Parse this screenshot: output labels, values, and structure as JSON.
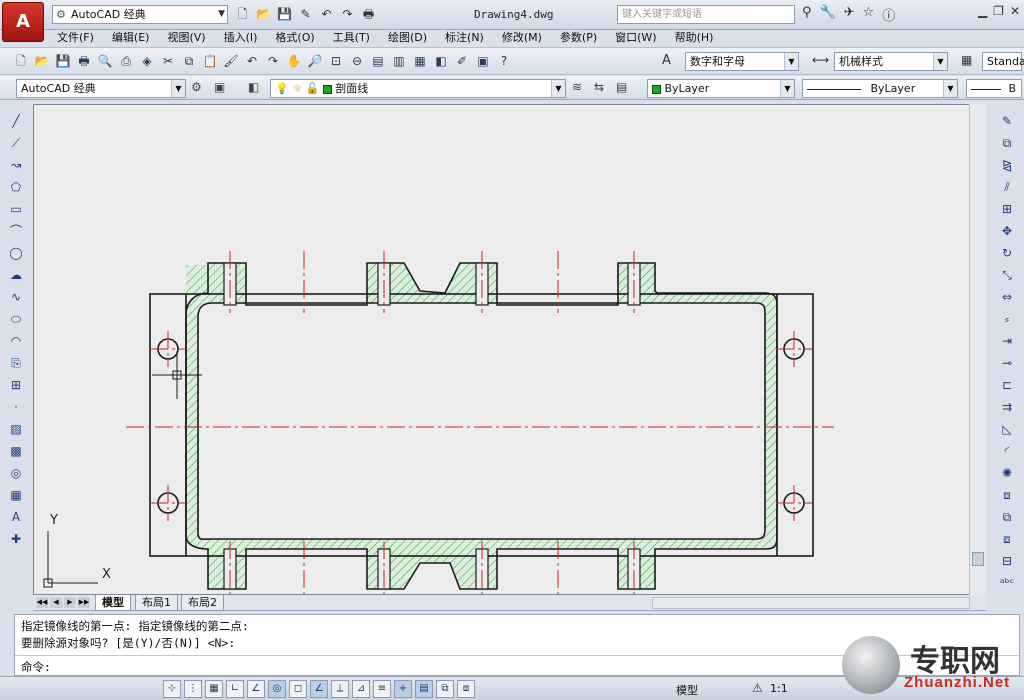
{
  "app": {
    "logo_letter": "A",
    "workspace": "AutoCAD 经典",
    "document_title": "Drawing4.dwg",
    "search_placeholder": "键入关键字或短语"
  },
  "menu": [
    "文件(F)",
    "编辑(E)",
    "视图(V)",
    "插入(I)",
    "格式(O)",
    "工具(T)",
    "绘图(D)",
    "标注(N)",
    "修改(M)",
    "参数(P)",
    "窗口(W)",
    "帮助(H)"
  ],
  "toolbar": {
    "text_style": "数字和字母",
    "dim_style": "机械样式",
    "table_style": "Standa",
    "workspace_combo": "AutoCAD 经典",
    "layer": "剖面线",
    "color": "ByLayer",
    "linetype": "ByLayer",
    "lineweight": "B"
  },
  "tabs": [
    "模型",
    "布局1",
    "布局2"
  ],
  "command": {
    "line1": "指定镜像线的第一点: 指定镜像线的第二点:",
    "line2": "要删除源对象吗? [是(Y)/否(N)] <N>:",
    "prompt": "命令:"
  },
  "status": {
    "model": "模型",
    "scale": "1:1"
  },
  "watermark": {
    "title": "专职网",
    "url": "Zhuanzhi.Net"
  },
  "ucs": {
    "x_label": "X",
    "y_label": "Y"
  },
  "colors": {
    "outline": "#1a1a1a",
    "centerline": "#d42020",
    "hatch": "#2e9a3c",
    "hatch_fill": "#cfe9cf"
  }
}
